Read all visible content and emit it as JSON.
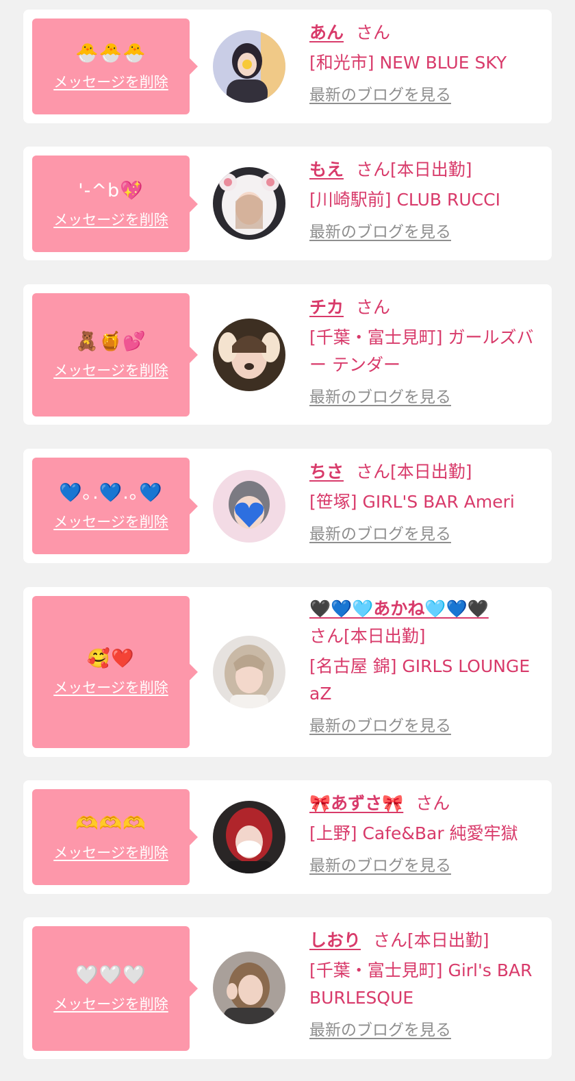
{
  "delete_label": "メッセージを削除",
  "blog_label": "最新のブログを見る",
  "san_label": "さん",
  "colors": {
    "accent": "#d83a6a",
    "bubble": "#fd97aa",
    "background": "#f1f1f1",
    "link_gray": "#8e8e8e"
  },
  "cards": [
    {
      "emoji": "🐣🐣🐣",
      "name": "あん",
      "suffix": "",
      "shop": "[和光市] NEW BLUE SKY",
      "avatar": "avatar-girl-hands-face"
    },
    {
      "emoji": "'-^b💖",
      "name": "もえ",
      "suffix": "[本日出勤]",
      "shop": "[川崎駅前] CLUB RUCCI",
      "avatar": "avatar-girl-bear-hood"
    },
    {
      "emoji": "🧸🍯💕",
      "name": "チカ",
      "suffix": "",
      "shop": "[千葉・富士見町] ガールズバー テンダー",
      "avatar": "avatar-girl-dog-filter"
    },
    {
      "emoji": "💙｡.💙.｡💙",
      "name": "ちさ",
      "suffix": "[本日出勤]",
      "shop": "[笹塚] GIRL'S BAR Ameri",
      "avatar": "avatar-girl-heart-face"
    },
    {
      "emoji": "🥰❤️",
      "name": "🖤💙🩵あかね🩵💙🖤",
      "suffix": "[本日出勤]",
      "shop": "[名古屋 錦] GIRLS LOUNGE aZ",
      "avatar": "avatar-girl-blonde"
    },
    {
      "emoji": "🫶🫶🫶",
      "name": "🎀あずさ🎀",
      "suffix": "",
      "shop": "[上野] Cafe&Bar 純愛牢獄",
      "avatar": "avatar-girl-red-hair"
    },
    {
      "emoji": "🤍🤍🤍",
      "name": "しおり",
      "suffix": "[本日出勤]",
      "shop": "[千葉・富士見町] Girl's BAR BURLESQUE",
      "avatar": "avatar-girl-peace-sign"
    }
  ]
}
